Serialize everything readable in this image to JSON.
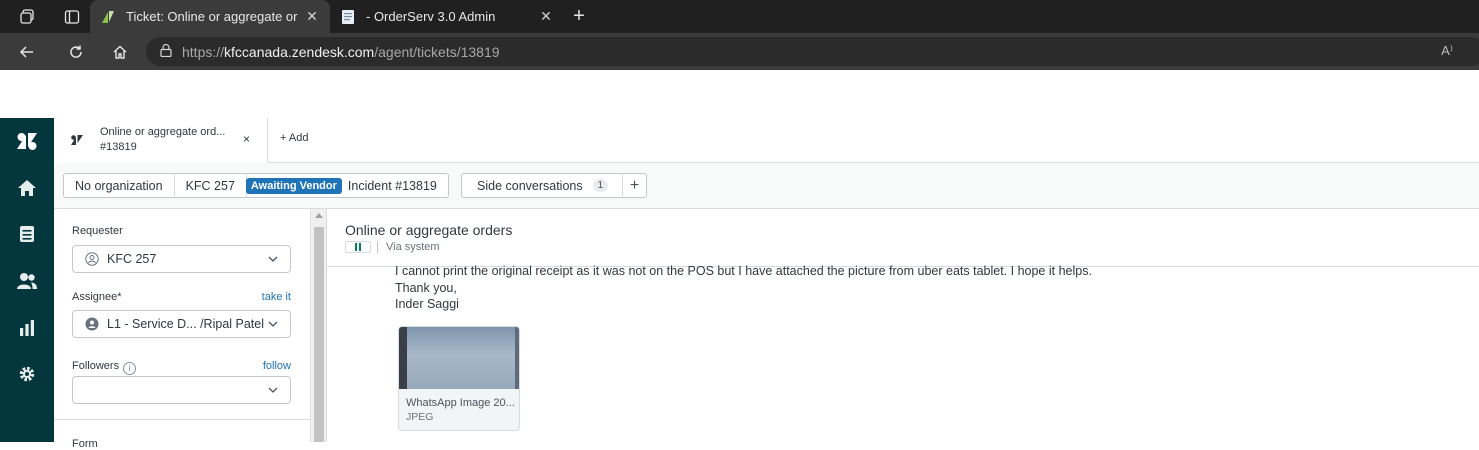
{
  "browser": {
    "tabs": [
      {
        "title": "Ticket: Online or aggregate orde",
        "active": true,
        "favicon": "zendesk-icon"
      },
      {
        "title": "- OrderServ 3.0 Admin",
        "active": false,
        "favicon": "document-icon"
      }
    ],
    "url_scheme": "https://",
    "url_host": "kfccanada.zendesk.com",
    "url_path": "/agent/tickets/13819",
    "read_aloud": "A⁾"
  },
  "workspace_tab": {
    "title": "Online or aggregate ord...",
    "ticket_id": "#13819",
    "close": "×",
    "add_label": "+ Add"
  },
  "breadcrumb": {
    "organization": "No organization",
    "requester": "KFC 257",
    "status_badge": "Awaiting Vendor",
    "ticket": "Incident #13819",
    "status_color": "#1f73b7"
  },
  "side_conversations": {
    "label": "Side conversations",
    "count": "1",
    "plus": "+"
  },
  "properties": {
    "requester_label": "Requester",
    "requester_value": "KFC 257",
    "assignee_label": "Assignee*",
    "assignee_link": "take it",
    "assignee_value": "L1 - Service D... /Ripal Patel",
    "followers_label": "Followers",
    "followers_link": "follow",
    "followers_value": "",
    "form_label": "Form"
  },
  "conversation": {
    "title": "Online or aggregate orders",
    "via": "Via system",
    "lines": [
      "I cannot print the original receipt as it was not on the POS but I have attached the picture from uber eats tablet. I hope it helps.",
      "Thank you,",
      "Inder Saggi"
    ],
    "attachment": {
      "name": "WhatsApp Image 20...",
      "type": "JPEG"
    }
  },
  "colors": {
    "sidebar": "#03363d",
    "brand_blue": "#1f73b7",
    "channel_green": "#038153"
  }
}
